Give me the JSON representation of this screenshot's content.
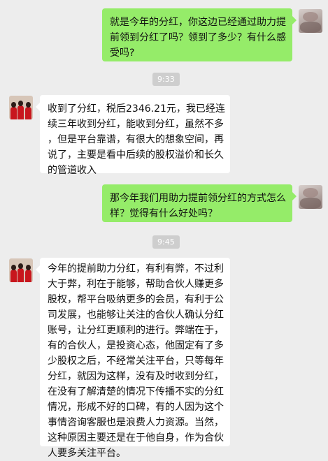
{
  "messages": [
    {
      "side": "right",
      "lines": [
        "就是今年的分红，你这边已经通过助力提",
        "前领到分红了吗？领到了多少？有什么感",
        "受吗?"
      ]
    },
    {
      "time": "9:33"
    },
    {
      "side": "left",
      "lines": [
        "收到了分红，税后2346.21元，我已经连",
        "续三年收到分红，能收到分红，虽然不多",
        "，但是平台靠谱，有很大的想象空间，再",
        "说了，主要是看中后续的股权溢价和长久",
        "的管道收入"
      ]
    },
    {
      "side": "right",
      "lines": [
        "那今年我们用助力提前领分红的方式怎么",
        "样？觉得有什么好处吗？"
      ]
    },
    {
      "time": "9:45"
    },
    {
      "side": "left",
      "lines": [
        "今年的提前助力分红，有利有弊，不过利",
        "大于弊，利在于能够，帮助合伙人赚更多",
        "股权，帮平台吸纳更多的会员，有利于公",
        "司发展，也能够让关注的合伙人确认分红",
        "账号，让分红更顺利的进行。弊端在于，",
        "有的合伙人，是投资心态，他固定有了多",
        "少股权之后，不经常关注平台，只等每年",
        "分红，就因为这样，没有及时收到分红，",
        "在没有了解清楚的情况下传播不实的分红",
        "情况，形成不好的口碑，有的人因为这个",
        "事情咨询客服也是浪费人力资源。当然，",
        "这种原因主要还是在于他自身，作为合伙",
        "人要多关注平台。"
      ]
    }
  ]
}
